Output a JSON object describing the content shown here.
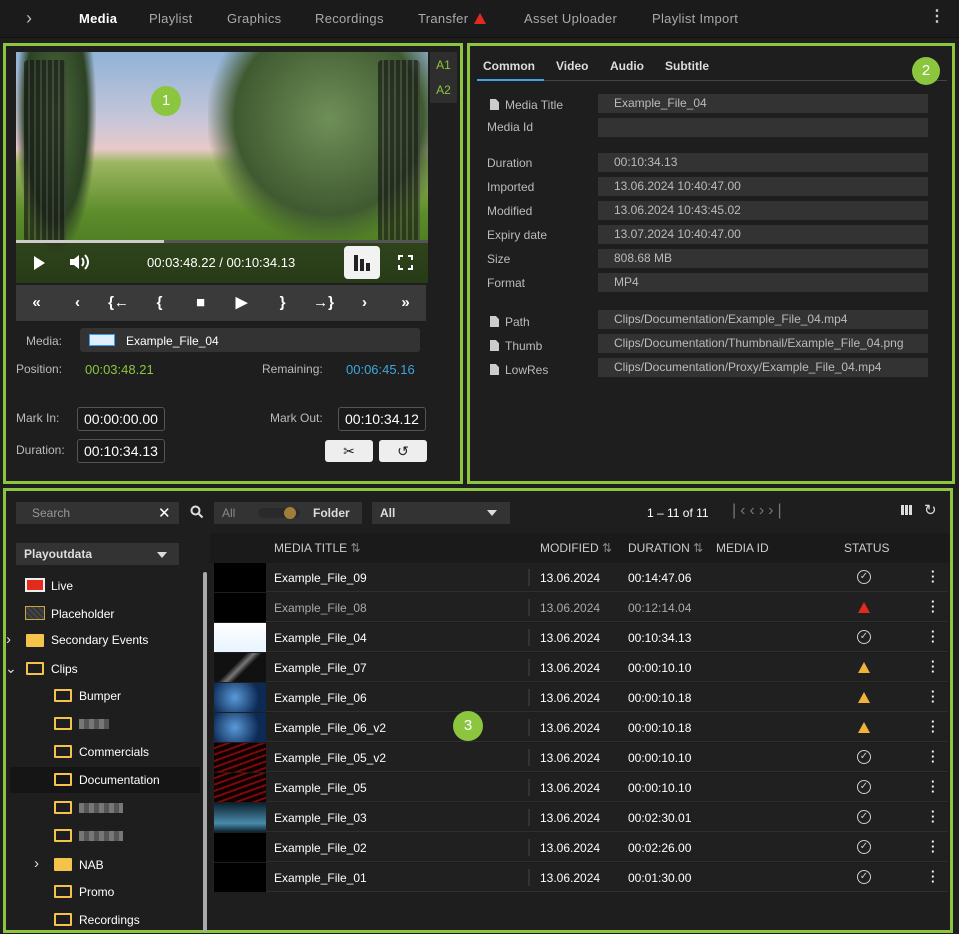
{
  "nav": {
    "items": [
      "Media",
      "Playlist",
      "Graphics",
      "Recordings",
      "Transfer",
      "Asset Uploader",
      "Playlist Import"
    ],
    "active": "Media"
  },
  "badges": [
    "1",
    "2",
    "3"
  ],
  "player": {
    "time": "00:03:48.22 / 00:10:34.13",
    "progress": 0.36,
    "audio_tabs": [
      "A1",
      "A2"
    ],
    "media_label": "Media:",
    "media_value": "Example_File_04",
    "position_label": "Position:",
    "position_value": "00:03:48.21",
    "remaining_label": "Remaining:",
    "remaining_value": "00:06:45.16",
    "markin_label": "Mark In:",
    "markin_value": "00:00:00.00",
    "markout_label": "Mark Out:",
    "markout_value": "00:10:34.12",
    "duration_label": "Duration:",
    "duration_value": "00:10:34.13",
    "colors": {
      "position": "#8cc63f",
      "remaining": "#3ea6e0"
    }
  },
  "props": {
    "tabs": [
      "Common",
      "Video",
      "Audio",
      "Subtitle"
    ],
    "fields": [
      {
        "label": "Media Title",
        "value": "Example_File_04"
      },
      {
        "label": "Media Id",
        "value": ""
      },
      {
        "label": "Duration",
        "value": "00:10:34.13"
      },
      {
        "label": "Imported",
        "value": "13.06.2024 10:40:47.00"
      },
      {
        "label": "Modified",
        "value": "13.06.2024 10:43:45.02"
      },
      {
        "label": "Expiry date",
        "value": "13.07.2024 10:40:47.00"
      },
      {
        "label": "Size",
        "value": "808.68 MB"
      },
      {
        "label": "Format",
        "value": "MP4"
      },
      {
        "label": "Path",
        "value": "Clips/Documentation/Example_File_04.mp4"
      },
      {
        "label": "Thumb",
        "value": "Clips/Documentation/Thumbnail/Example_File_04.png"
      },
      {
        "label": "LowRes",
        "value": "Clips/Documentation/Proxy/Example_File_04.mp4"
      }
    ]
  },
  "library": {
    "search_placeholder": "Search",
    "filter_all": "All",
    "folder_label": "Folder",
    "type_select": "All",
    "pager": "1 – 11 of 11",
    "source": "Playoutdata",
    "tree": {
      "live": "Live",
      "placeholder": "Placeholder",
      "secondary": "Secondary Events",
      "clips": "Clips",
      "bumper": "Bumper",
      "commercials": "Commercials",
      "documentation": "Documentation",
      "nab": "NAB",
      "promo": "Promo",
      "recordings": "Recordings"
    },
    "columns": [
      "MEDIA TITLE",
      "MODIFIED",
      "DURATION",
      "MEDIA ID",
      "STATUS"
    ],
    "rows": [
      {
        "title": "Example_File_09",
        "modified": "13.06.2024",
        "duration": "00:14:47.06",
        "status": "ok"
      },
      {
        "title": "Example_File_08",
        "modified": "13.06.2024",
        "duration": "00:12:14.04",
        "status": "error"
      },
      {
        "title": "Example_File_04",
        "modified": "13.06.2024",
        "duration": "00:10:34.13",
        "status": "ok"
      },
      {
        "title": "Example_File_07",
        "modified": "13.06.2024",
        "duration": "00:00:10.10",
        "status": "warning"
      },
      {
        "title": "Example_File_06",
        "modified": "13.06.2024",
        "duration": "00:00:10.18",
        "status": "warning"
      },
      {
        "title": "Example_File_06_v2",
        "modified": "13.06.2024",
        "duration": "00:00:10.18",
        "status": "warning"
      },
      {
        "title": "Example_File_05_v2",
        "modified": "13.06.2024",
        "duration": "00:00:10.10",
        "status": "ok"
      },
      {
        "title": "Example_File_05",
        "modified": "13.06.2024",
        "duration": "00:00:10.10",
        "status": "ok"
      },
      {
        "title": "Example_File_03",
        "modified": "13.06.2024",
        "duration": "00:02:30.01",
        "status": "ok"
      },
      {
        "title": "Example_File_02",
        "modified": "13.06.2024",
        "duration": "00:02:26.00",
        "status": "ok"
      },
      {
        "title": "Example_File_01",
        "modified": "13.06.2024",
        "duration": "00:01:30.00",
        "status": "ok"
      }
    ]
  },
  "accent": "#8cc63f"
}
